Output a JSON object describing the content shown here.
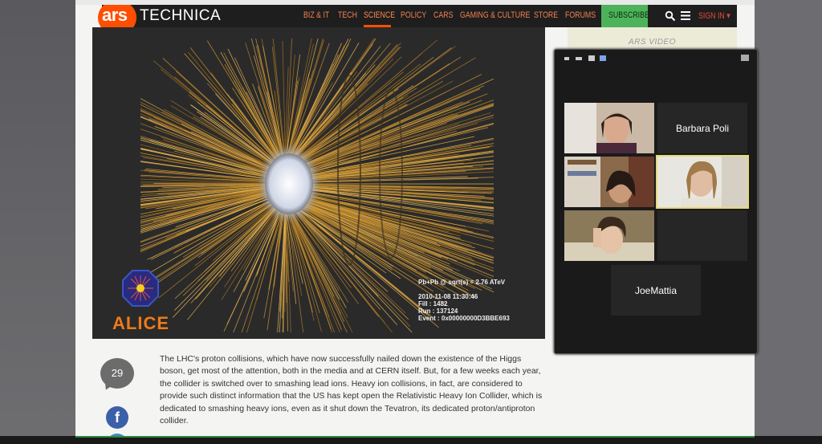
{
  "nav": {
    "logo_ars": "ars",
    "logo_technica": "TECHNICA",
    "items": [
      "BIZ & IT",
      "TECH",
      "SCIENCE",
      "POLICY",
      "CARS",
      "GAMING & CULTURE",
      "STORE",
      "FORUMS"
    ],
    "subscribe": "SUBSCRIBE",
    "signin": "SIGN IN ▾"
  },
  "sidebar": {
    "ars_video": "ARS VIDEO"
  },
  "photo": {
    "event_line1": "Pb+Pb @ sqrt(s) = 2.76 ATeV",
    "event_line2": "2010-11-08 11:30:46",
    "event_line3": "Fill : 1482",
    "event_line4": "Run : 137124",
    "event_line5": "Event : 0x00000000D3BBE693",
    "alice": "ALICE"
  },
  "comments": {
    "count": "29"
  },
  "article": {
    "paragraph": "The LHC's proton collisions, which have now successfully nailed down the existence of the Higgs boson, get most of the attention, both in the media and at CERN itself. But, for a few weeks each year, the collider is switched over to smashing lead ions. Heavy ion collisions, in fact, are considered to provide such distinct information that the US has kept open the Relativistic Heavy Ion Collider, which is dedicated to smashing heavy ions, even as it shut down the Tevatron, its dedicated proton/antiproton collider."
  },
  "zoom": {
    "participants": [
      {
        "name": "",
        "video": true
      },
      {
        "name": "Barbara Poli",
        "video": false
      },
      {
        "name": "",
        "video": true
      },
      {
        "name": "",
        "video": true,
        "active": true
      },
      {
        "name": "",
        "video": true
      },
      {
        "name": "",
        "video": false
      },
      {
        "name": "JoeMattia",
        "video": false
      }
    ]
  },
  "colors": {
    "accent": "#ff4e00",
    "subscribe": "#4db35a",
    "nav_bg": "#1e1e1e",
    "speaker_outline": "#e4d978"
  }
}
